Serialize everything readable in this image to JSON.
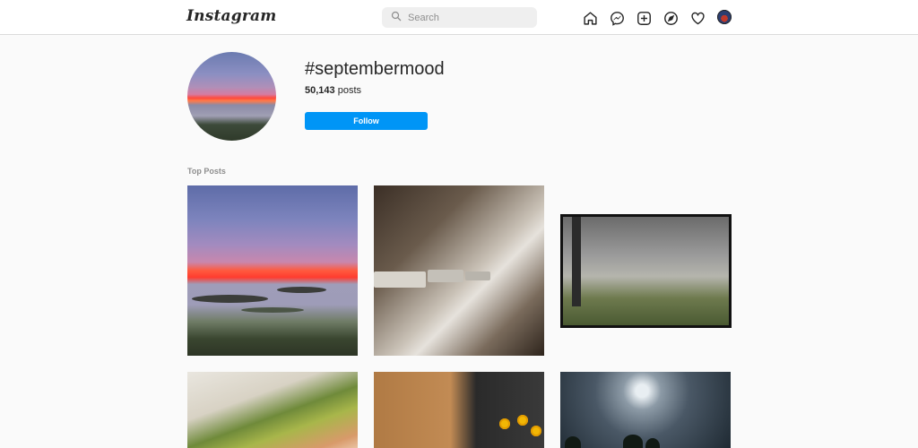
{
  "header": {
    "logo": "Instagram",
    "search": {
      "placeholder": "Search"
    },
    "nav": [
      {
        "name": "home-icon"
      },
      {
        "name": "messenger-icon"
      },
      {
        "name": "new-post-icon"
      },
      {
        "name": "explore-icon"
      },
      {
        "name": "activity-heart-icon"
      },
      {
        "name": "profile-avatar"
      }
    ]
  },
  "hashtag": {
    "title": "#septembermood",
    "count": "50,143",
    "count_suffix": " posts",
    "follow_label": "Follow"
  },
  "section": {
    "top_posts_label": "Top Posts"
  },
  "colors": {
    "accent": "#0095f6",
    "text": "#262626",
    "muted": "#8e8e8e",
    "border": "#dbdbdb",
    "background": "#fafafa"
  }
}
